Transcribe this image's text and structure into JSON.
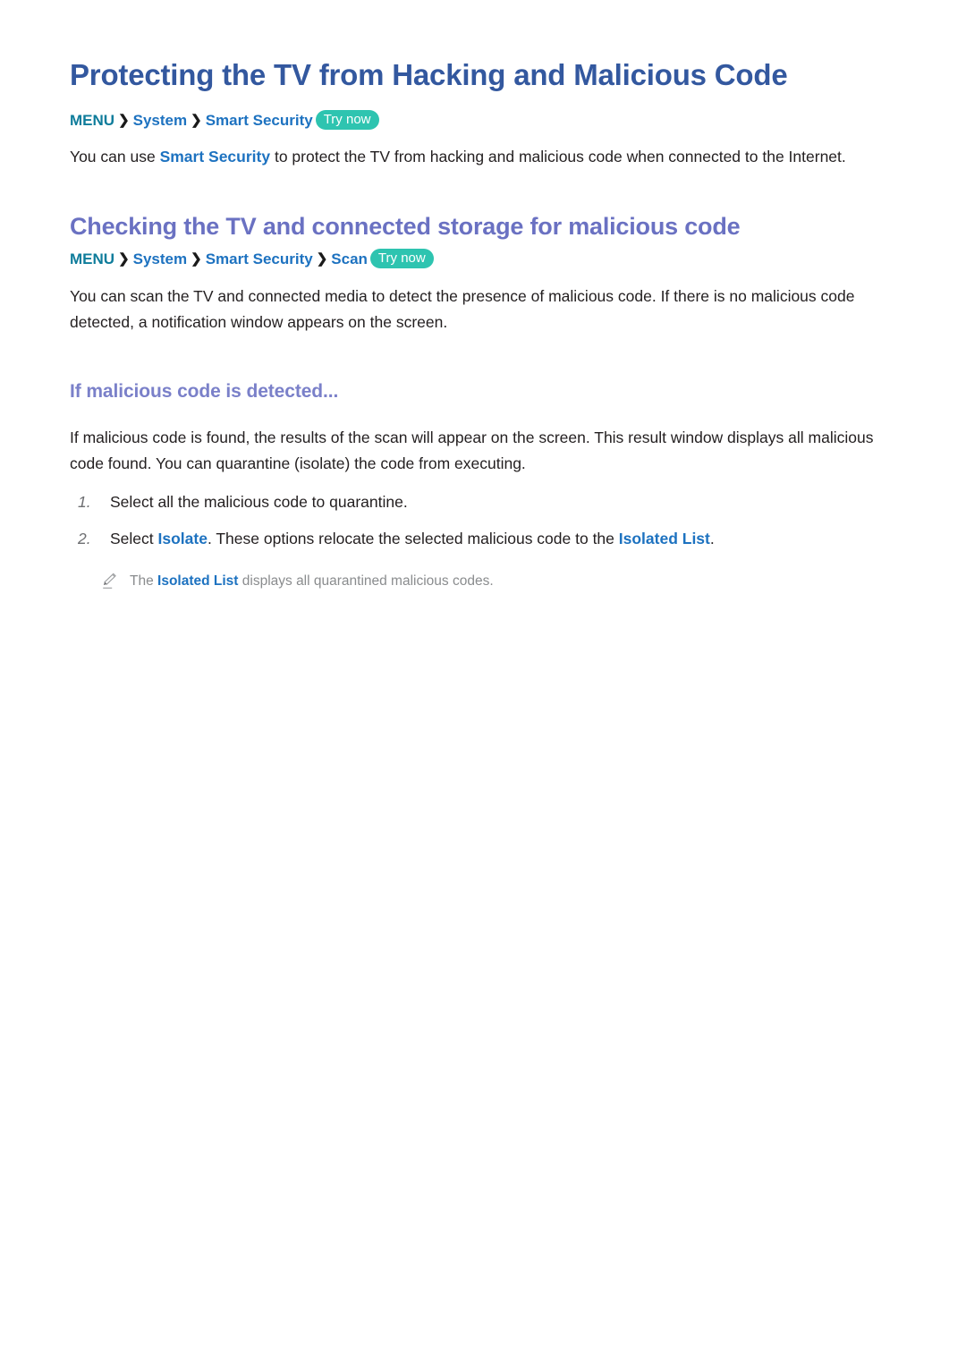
{
  "colors": {
    "page_background": "#ffffff",
    "title_blue": "#33589f",
    "section_violet": "#6a71c2",
    "sub_violet": "#7a80c9",
    "link_blue": "#1d72c0",
    "menu_teal": "#0e7c9b",
    "badge_teal": "#2ec4b0",
    "body_text": "#231f20",
    "note_gray": "#8a8c8e",
    "step_number_gray": "#6d6e71"
  },
  "doc": {
    "title": "Protecting the TV from Hacking and Malicious Code"
  },
  "breadcrumb_1": {
    "menu": "MENU",
    "separator": "❯",
    "item_1": "System",
    "item_2": "Smart Security",
    "badge": "Try now"
  },
  "intro": {
    "before_link": "You can use ",
    "link": "Smart Security",
    "after_link": " to protect the TV from hacking and malicious code when connected to the Internet."
  },
  "section_1": {
    "heading": "Checking the TV and connected storage for malicious code",
    "breadcrumb": {
      "menu": "MENU",
      "separator": "❯",
      "item_1": "System",
      "item_2": "Smart Security",
      "item_3": "Scan",
      "badge": "Try now"
    },
    "body": "You can scan the TV and connected media to detect the presence of malicious code. If there is no malicious code detected, a notification window appears on the screen."
  },
  "section_2": {
    "heading": "If malicious code is detected...",
    "body": "If malicious code is found, the results of the scan will appear on the screen. This result window displays all malicious code found. You can quarantine (isolate) the code from executing.",
    "steps": [
      {
        "number": "1.",
        "text": "Select all the malicious code to quarantine."
      },
      {
        "number": "2.",
        "before_link_1": "Select ",
        "link_1": "Isolate",
        "between": ". These options relocate the selected malicious code to the ",
        "link_2": "Isolated List",
        "after": "."
      }
    ],
    "note": {
      "icon": "pencil-icon",
      "before_link": "The ",
      "link": "Isolated List",
      "after_link": " displays all quarantined malicious codes."
    }
  }
}
